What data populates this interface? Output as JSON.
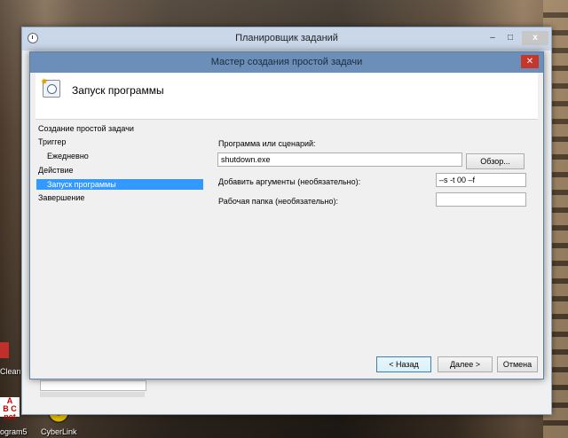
{
  "background_window": {
    "title": "Планировщик заданий",
    "minimize_glyph": "–",
    "maximize_glyph": "□",
    "close_glyph": "x"
  },
  "dialog": {
    "title": "Мастер создания простой задачи",
    "close_glyph": "✕",
    "header_title": "Запуск программы"
  },
  "nav": {
    "items": [
      {
        "label": "Создание простой задачи",
        "selected": false
      },
      {
        "label": "Триггер",
        "selected": false
      },
      {
        "label": "Ежедневно",
        "selected": false
      },
      {
        "label": "Действие",
        "selected": false
      },
      {
        "label": "Запуск программы",
        "selected": true
      },
      {
        "label": "Завершение",
        "selected": false
      }
    ]
  },
  "form": {
    "program_label": "Программа или сценарий:",
    "program_value": "shutdown.exe",
    "browse_button": "Обзор...",
    "args_label": "Добавить аргументы (необязательно):",
    "args_value": "–s -t 00 –f",
    "workdir_label": "Рабочая папка (необязательно):",
    "workdir_value": ""
  },
  "buttons": {
    "back": "< Назад",
    "next": "Далее >",
    "cancel": "Отмена"
  },
  "desktop_icons": [
    {
      "label": "Clean",
      "icon": "red-app-icon"
    },
    {
      "label": "ogram5",
      "icon": "abc-net-icon"
    },
    {
      "label": "CyberLink",
      "icon": "cyberlink-disc-icon"
    }
  ],
  "colors": {
    "dialog_titlebar": "#6b8fb9",
    "selection": "#3399ff",
    "close_button": "#c7362b"
  }
}
